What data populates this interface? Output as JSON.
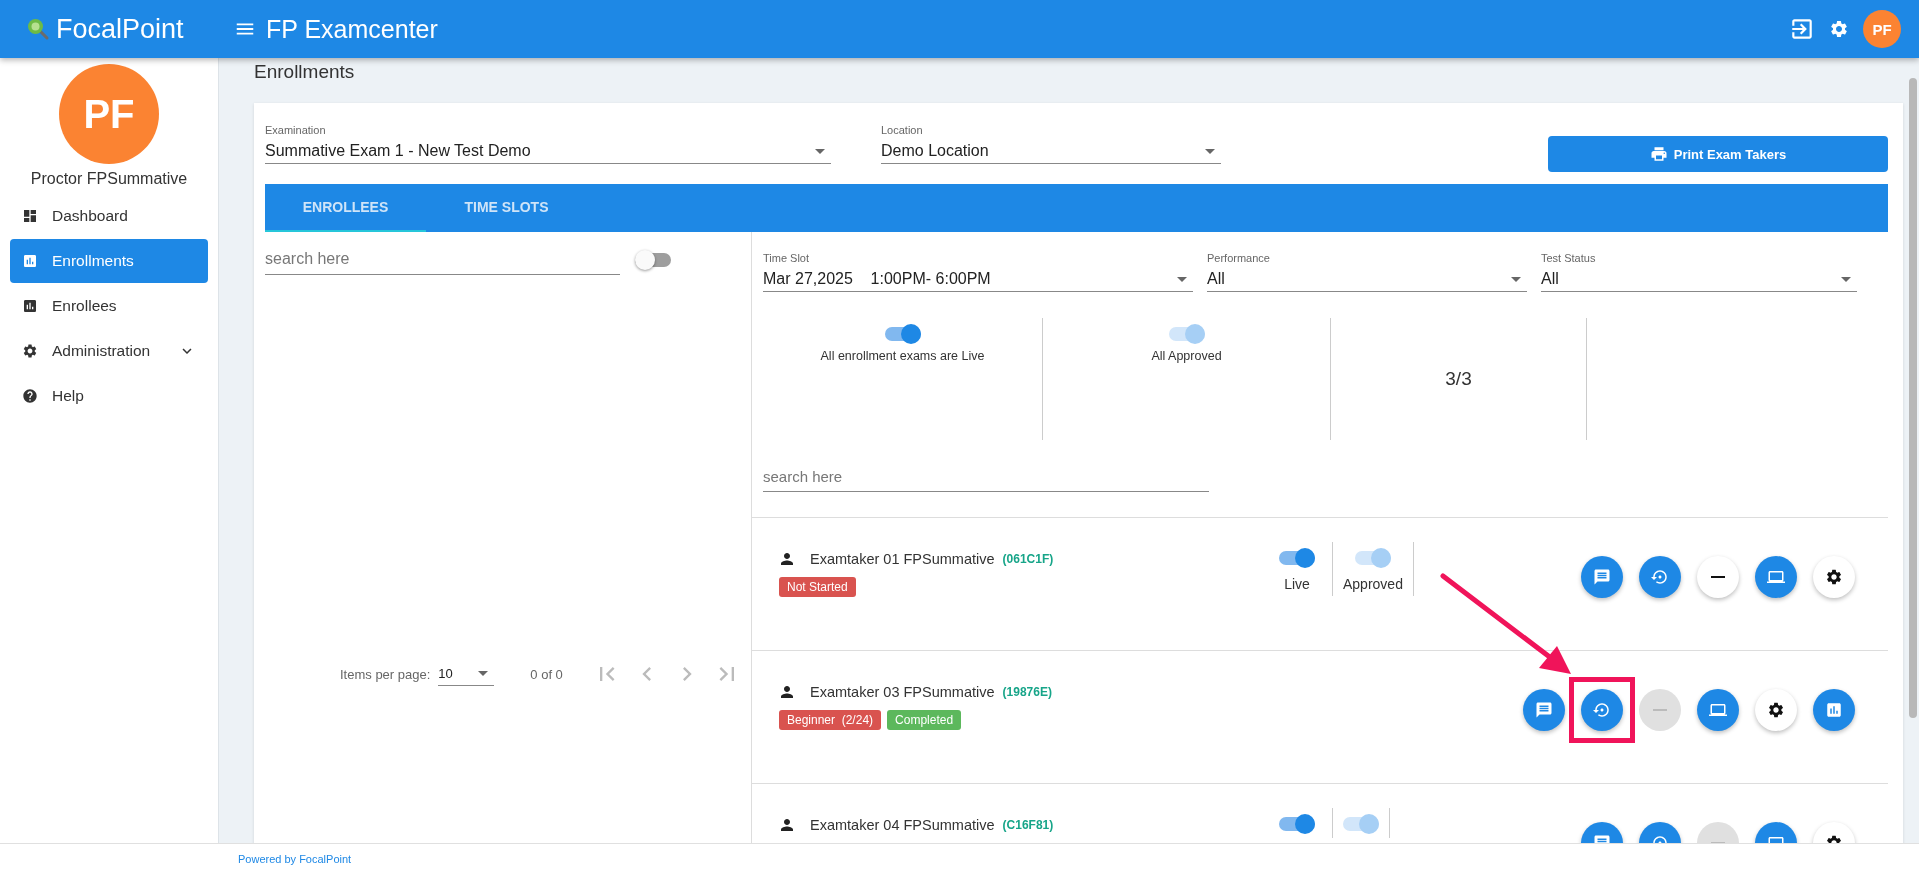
{
  "header": {
    "brand": "FocalPoint",
    "title": "FP Examcenter",
    "avatar": "PF"
  },
  "sidebar": {
    "avatar": "PF",
    "user": "Proctor FPSummative",
    "items": [
      {
        "label": "Dashboard",
        "kind": "dashboard",
        "selected": false
      },
      {
        "label": "Enrollments",
        "kind": "chart",
        "selected": true
      },
      {
        "label": "Enrollees",
        "kind": "chart",
        "selected": false
      },
      {
        "label": "Administration",
        "kind": "settings",
        "selected": false,
        "expanded": false
      },
      {
        "label": "Help",
        "kind": "help",
        "selected": false
      }
    ]
  },
  "page_title": "Enrollments",
  "filters": [
    {
      "label": "Examination",
      "value": "Summative Exam 1 - New Test Demo"
    },
    {
      "label": "Location",
      "value": "Demo Location"
    }
  ],
  "print_button": "Print Exam Takers",
  "tabs": [
    {
      "label": "ENROLLEES",
      "selected": true
    },
    {
      "label": "TIME SLOTS",
      "selected": false
    }
  ],
  "left_panel": {
    "search": {
      "placeholder": "search here"
    },
    "toggle": {
      "on": false
    },
    "pagination": {
      "label": "Items per page:",
      "page_size": "10",
      "range": "0 of 0"
    }
  },
  "right_panel": {
    "filters": [
      {
        "label": "Time Slot",
        "value": "Mar 27,2025    1:00PM- 6:00PM"
      },
      {
        "label": "Performance",
        "value": "All"
      },
      {
        "label": "Test Status",
        "value": "All"
      }
    ],
    "summary": [
      {
        "kind": "toggle",
        "label": "All enrollment exams are Live",
        "on": true,
        "disabled": false
      },
      {
        "kind": "toggle",
        "label": "All Approved",
        "on": true,
        "disabled": true
      },
      {
        "kind": "count",
        "value": "3/3"
      }
    ],
    "search": {
      "placeholder": "search here"
    },
    "enrollees": [
      {
        "name": "Examtaker 01 FPSummative",
        "code": "(061C1F)",
        "badges": [
          {
            "text": "Not Started",
            "color": "#d9534f"
          }
        ],
        "live": {
          "label": "Live",
          "on": true,
          "disabled": false
        },
        "approved": {
          "label": "Approved",
          "on": true,
          "disabled": true
        },
        "actions": [
          {
            "kind": "chat",
            "filled": true,
            "disabled": false,
            "highlighted": false
          },
          {
            "kind": "restore",
            "filled": true,
            "disabled": false,
            "highlighted": false
          },
          {
            "kind": "minus",
            "filled": false,
            "disabled": false,
            "highlighted": false
          },
          {
            "kind": "laptop",
            "filled": true,
            "disabled": false,
            "highlighted": false
          },
          {
            "kind": "settings",
            "filled": false,
            "disabled": false,
            "highlighted": false
          }
        ]
      },
      {
        "name": "Examtaker 03 FPSummative",
        "code": "(19876E)",
        "badges": [
          {
            "text": "Beginner  (2/24)",
            "color": "#d9534f"
          },
          {
            "text": "Completed",
            "color": "#5cb85c"
          }
        ],
        "actions": [
          {
            "kind": "chat",
            "filled": true,
            "disabled": false,
            "highlighted": false
          },
          {
            "kind": "restore",
            "filled": true,
            "disabled": false,
            "highlighted": true
          },
          {
            "kind": "minus",
            "filled": false,
            "disabled": true,
            "highlighted": false
          },
          {
            "kind": "laptop",
            "filled": true,
            "disabled": false,
            "highlighted": false
          },
          {
            "kind": "settings",
            "filled": false,
            "disabled": false,
            "highlighted": false
          },
          {
            "kind": "chart",
            "filled": true,
            "disabled": false,
            "highlighted": false
          }
        ]
      },
      {
        "name": "Examtaker 04 FPSummative",
        "code": "(C16F81)",
        "live": {
          "on": true,
          "disabled": false
        },
        "approved": {
          "on": true,
          "disabled": true
        },
        "actions": [
          {
            "kind": "chat",
            "filled": true,
            "disabled": false,
            "highlighted": false
          },
          {
            "kind": "restore",
            "filled": true,
            "disabled": false,
            "highlighted": false
          },
          {
            "kind": "minus",
            "filled": false,
            "disabled": true,
            "highlighted": false
          },
          {
            "kind": "laptop",
            "filled": true,
            "disabled": false,
            "highlighted": false
          },
          {
            "kind": "settings",
            "filled": false,
            "disabled": false,
            "highlighted": false
          }
        ]
      }
    ]
  },
  "footer": "Powered by FocalPoint"
}
